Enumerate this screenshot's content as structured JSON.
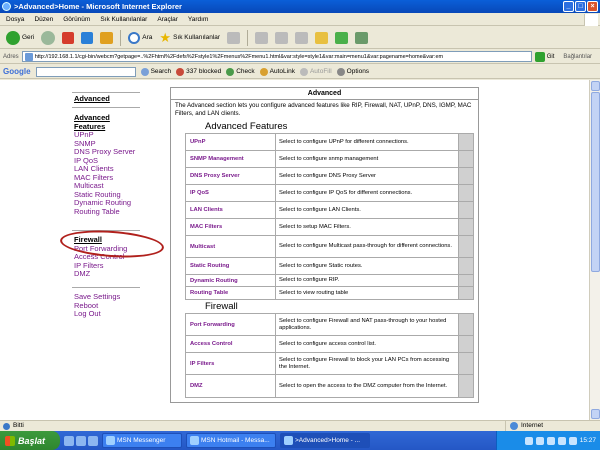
{
  "window": {
    "title": ">Advanced>Home - Microsoft Internet Explorer",
    "buttons": [
      "_",
      "□",
      "×"
    ]
  },
  "menubar": [
    "Dosya",
    "Düzen",
    "Görünüm",
    "Sık Kullanılanlar",
    "Araçlar",
    "Yardım"
  ],
  "toolbar": {
    "back": "Geri",
    "search": "Ara",
    "favorites": "Sık Kullanılanlar"
  },
  "address": {
    "label": "Adres",
    "url": "http://192.168.1.1/cgi-bin/webcm?getpage=..%2Fhtml%2Fdefs%2Fstyle1%2Fmenus%2Fmenu1.html&var:style=style1&var:main=menu1&var:pagename=home&var:em",
    "go": "Git",
    "links": "Bağlantılar"
  },
  "google": {
    "logo": "Google",
    "search": "Search",
    "blocked": "337 blocked",
    "check": "Check",
    "autolink": "AutoLink",
    "autofill": "AutoFill",
    "options": "Options"
  },
  "leftnav": {
    "advanced_head": "Advanced",
    "advanced_features_head": "Advanced Features",
    "advanced_items": [
      "UPnP",
      "SNMP",
      "DNS Proxy Server",
      "IP QoS",
      "LAN Clients",
      "MAC Filters",
      "Multicast",
      "Static Routing",
      "Dynamic Routing",
      "Routing Table"
    ],
    "firewall_head": "Firewall",
    "firewall_items": [
      "Port Forwarding",
      "Access Control",
      "IP Filters",
      "DMZ"
    ],
    "bottom_items": [
      "Save Settings",
      "Reboot",
      "Log Out"
    ]
  },
  "panel": {
    "title": "Advanced",
    "intro": "The Advanced section lets you configure advanced features like RIP, Firewall, NAT, UPnP, DNS, IGMP, MAC Filters, and LAN clients.",
    "advanced_heading": "Advanced Features",
    "advanced_rows": [
      {
        "name": "UPnP",
        "desc": "Select to configure UPnP for different connections."
      },
      {
        "name": "SNMP Management",
        "desc": "Select to configure snmp management"
      },
      {
        "name": "DNS Proxy Server",
        "desc": "Select to configure DNS Proxy Server"
      },
      {
        "name": "IP QoS",
        "desc": "Select to configure IP QoS for different connections."
      },
      {
        "name": "LAN Clients",
        "desc": "Select to configure LAN Clients."
      },
      {
        "name": "MAC Filters",
        "desc": "Select to setup MAC Filters."
      },
      {
        "name": "Multicast",
        "desc": "Select to configure Multicast pass-through for different connections."
      },
      {
        "name": "Static Routing",
        "desc": "Select to configure Static routes."
      },
      {
        "name": "Dynamic Routing",
        "desc": "Select to configure RIP."
      },
      {
        "name": "Routing Table",
        "desc": "Select to view routing table"
      }
    ],
    "firewall_heading": "Firewall",
    "firewall_rows": [
      {
        "name": "Port Forwarding",
        "desc": "Select to configure Firewall and NAT pass-through to your hosted applications."
      },
      {
        "name": "Access Control",
        "desc": "Select to configure access control list."
      },
      {
        "name": "IP Filters",
        "desc": "Select to configure Firewall to block your LAN PCs from accessing the Internet."
      },
      {
        "name": "DMZ",
        "desc": "Select to open the access to the DMZ computer from the Internet."
      }
    ]
  },
  "status": {
    "left": "Bitti",
    "zone": "Internet"
  },
  "taskbar": {
    "start": "Başlat",
    "tasks": [
      "MSN Messenger",
      "MSN Hotmail - Messa...",
      ">Advanced>Home - ..."
    ],
    "clock": "15:27"
  },
  "colors": {
    "link": "#7a1a8c",
    "annotation": "#b0201c",
    "titlebar": "#0a5fd8"
  }
}
